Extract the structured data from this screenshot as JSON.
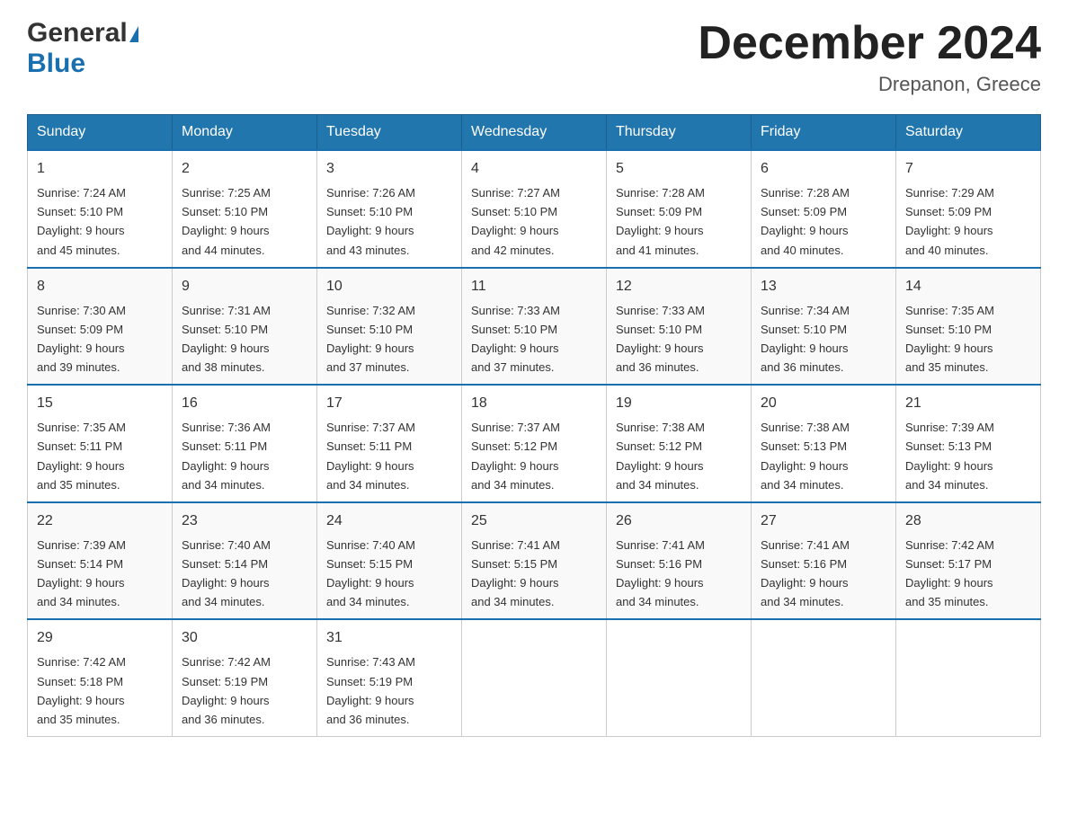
{
  "logo": {
    "general_text": "General",
    "blue_text": "Blue"
  },
  "header": {
    "month_year": "December 2024",
    "location": "Drepanon, Greece"
  },
  "weekdays": [
    "Sunday",
    "Monday",
    "Tuesday",
    "Wednesday",
    "Thursday",
    "Friday",
    "Saturday"
  ],
  "weeks": [
    [
      {
        "day": "1",
        "sunrise": "7:24 AM",
        "sunset": "5:10 PM",
        "daylight": "9 hours and 45 minutes."
      },
      {
        "day": "2",
        "sunrise": "7:25 AM",
        "sunset": "5:10 PM",
        "daylight": "9 hours and 44 minutes."
      },
      {
        "day": "3",
        "sunrise": "7:26 AM",
        "sunset": "5:10 PM",
        "daylight": "9 hours and 43 minutes."
      },
      {
        "day": "4",
        "sunrise": "7:27 AM",
        "sunset": "5:10 PM",
        "daylight": "9 hours and 42 minutes."
      },
      {
        "day": "5",
        "sunrise": "7:28 AM",
        "sunset": "5:09 PM",
        "daylight": "9 hours and 41 minutes."
      },
      {
        "day": "6",
        "sunrise": "7:28 AM",
        "sunset": "5:09 PM",
        "daylight": "9 hours and 40 minutes."
      },
      {
        "day": "7",
        "sunrise": "7:29 AM",
        "sunset": "5:09 PM",
        "daylight": "9 hours and 40 minutes."
      }
    ],
    [
      {
        "day": "8",
        "sunrise": "7:30 AM",
        "sunset": "5:09 PM",
        "daylight": "9 hours and 39 minutes."
      },
      {
        "day": "9",
        "sunrise": "7:31 AM",
        "sunset": "5:10 PM",
        "daylight": "9 hours and 38 minutes."
      },
      {
        "day": "10",
        "sunrise": "7:32 AM",
        "sunset": "5:10 PM",
        "daylight": "9 hours and 37 minutes."
      },
      {
        "day": "11",
        "sunrise": "7:33 AM",
        "sunset": "5:10 PM",
        "daylight": "9 hours and 37 minutes."
      },
      {
        "day": "12",
        "sunrise": "7:33 AM",
        "sunset": "5:10 PM",
        "daylight": "9 hours and 36 minutes."
      },
      {
        "day": "13",
        "sunrise": "7:34 AM",
        "sunset": "5:10 PM",
        "daylight": "9 hours and 36 minutes."
      },
      {
        "day": "14",
        "sunrise": "7:35 AM",
        "sunset": "5:10 PM",
        "daylight": "9 hours and 35 minutes."
      }
    ],
    [
      {
        "day": "15",
        "sunrise": "7:35 AM",
        "sunset": "5:11 PM",
        "daylight": "9 hours and 35 minutes."
      },
      {
        "day": "16",
        "sunrise": "7:36 AM",
        "sunset": "5:11 PM",
        "daylight": "9 hours and 34 minutes."
      },
      {
        "day": "17",
        "sunrise": "7:37 AM",
        "sunset": "5:11 PM",
        "daylight": "9 hours and 34 minutes."
      },
      {
        "day": "18",
        "sunrise": "7:37 AM",
        "sunset": "5:12 PM",
        "daylight": "9 hours and 34 minutes."
      },
      {
        "day": "19",
        "sunrise": "7:38 AM",
        "sunset": "5:12 PM",
        "daylight": "9 hours and 34 minutes."
      },
      {
        "day": "20",
        "sunrise": "7:38 AM",
        "sunset": "5:13 PM",
        "daylight": "9 hours and 34 minutes."
      },
      {
        "day": "21",
        "sunrise": "7:39 AM",
        "sunset": "5:13 PM",
        "daylight": "9 hours and 34 minutes."
      }
    ],
    [
      {
        "day": "22",
        "sunrise": "7:39 AM",
        "sunset": "5:14 PM",
        "daylight": "9 hours and 34 minutes."
      },
      {
        "day": "23",
        "sunrise": "7:40 AM",
        "sunset": "5:14 PM",
        "daylight": "9 hours and 34 minutes."
      },
      {
        "day": "24",
        "sunrise": "7:40 AM",
        "sunset": "5:15 PM",
        "daylight": "9 hours and 34 minutes."
      },
      {
        "day": "25",
        "sunrise": "7:41 AM",
        "sunset": "5:15 PM",
        "daylight": "9 hours and 34 minutes."
      },
      {
        "day": "26",
        "sunrise": "7:41 AM",
        "sunset": "5:16 PM",
        "daylight": "9 hours and 34 minutes."
      },
      {
        "day": "27",
        "sunrise": "7:41 AM",
        "sunset": "5:16 PM",
        "daylight": "9 hours and 34 minutes."
      },
      {
        "day": "28",
        "sunrise": "7:42 AM",
        "sunset": "5:17 PM",
        "daylight": "9 hours and 35 minutes."
      }
    ],
    [
      {
        "day": "29",
        "sunrise": "7:42 AM",
        "sunset": "5:18 PM",
        "daylight": "9 hours and 35 minutes."
      },
      {
        "day": "30",
        "sunrise": "7:42 AM",
        "sunset": "5:19 PM",
        "daylight": "9 hours and 36 minutes."
      },
      {
        "day": "31",
        "sunrise": "7:43 AM",
        "sunset": "5:19 PM",
        "daylight": "9 hours and 36 minutes."
      },
      null,
      null,
      null,
      null
    ]
  ]
}
